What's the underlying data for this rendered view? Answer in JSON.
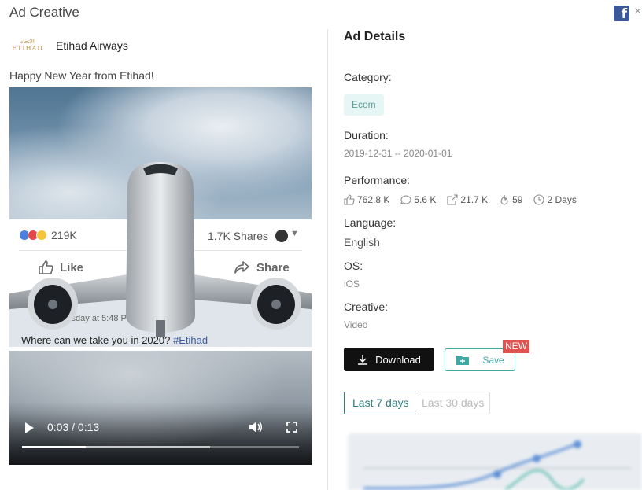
{
  "modal": {
    "title": "Ad Creative",
    "facebook_icon": "facebook-logo-icon",
    "close_label": "×"
  },
  "advertiser": {
    "logo_arabic": "الاتحاد",
    "logo_text": "ETIHAD",
    "name": "Etihad Airways"
  },
  "ad_text": "Happy New Year from Etihad!",
  "video_overlay": {
    "reaction_count": "219K",
    "shares": "1.7K Shares",
    "like_label": "Like",
    "share_label": "Share",
    "post_date": "Tuesday at 5:48 PM",
    "post_text_lead": "Where can we take you in 2020?",
    "post_hashtag": "#Etihad"
  },
  "video_player": {
    "current_time": "0:03",
    "duration": "0:13",
    "time_display": "0:03 / 0:13",
    "played_fraction": 0.23,
    "buffered_fraction": 0.68
  },
  "details": {
    "title": "Ad Details",
    "category_label": "Category:",
    "category_value": "Ecom",
    "duration_label": "Duration:",
    "duration_value": "2019-12-31 -- 2020-01-01",
    "performance_label": "Performance:",
    "performance": {
      "likes": "762.8 K",
      "comments": "5.6 K",
      "shares": "21.7 K",
      "hot": "59",
      "days": "2 Days"
    },
    "language_label": "Language:",
    "language_value": "English",
    "os_label": "OS:",
    "os_value": "iOS",
    "creative_label": "Creative:",
    "creative_value": "Video"
  },
  "actions": {
    "download_label": "Download",
    "save_label": "Save",
    "new_badge": "NEW"
  },
  "range_tabs": {
    "last7": "Last 7 days",
    "last30": "Last 30 days",
    "active": "last7"
  },
  "colors": {
    "accent_teal": "#3fa9a3",
    "badge_red": "#e0514f",
    "facebook_blue": "#3b5998"
  }
}
